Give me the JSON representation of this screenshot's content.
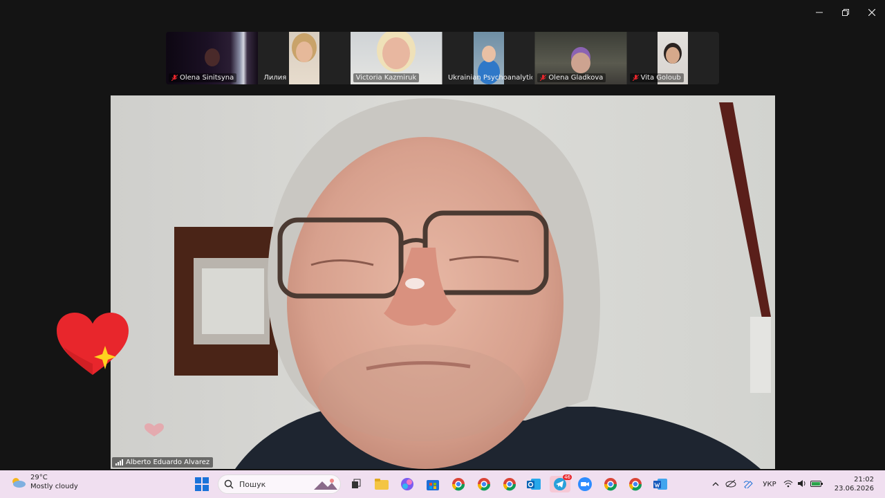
{
  "window": {
    "controls": [
      "minimize-icon",
      "restore-icon",
      "close-icon"
    ]
  },
  "participants": [
    {
      "name": "Olena Sinitsyna",
      "muted": true
    },
    {
      "name": "Лилия",
      "muted": false
    },
    {
      "name": "Victoria Kazmiruk",
      "muted": false
    },
    {
      "name": "Ukrainian Psychoanalytic ...",
      "muted": false
    },
    {
      "name": "Olena Gladkova",
      "muted": true
    },
    {
      "name": "Vita Goloub",
      "muted": true
    }
  ],
  "speaker": {
    "name": "Alberto Eduardo Alvarez"
  },
  "reactions": [
    "heart-icon",
    "sparkle-icon"
  ],
  "taskbar": {
    "weather": {
      "temp": "29°C",
      "desc": "Mostly cloudy"
    },
    "search_placeholder": "Пошук",
    "telegram_badge": "46",
    "language": "УКР",
    "time": "21:02",
    "date": "23.06.2026"
  },
  "colors": {
    "accent_red": "#e8262c",
    "taskbar_bg": "#f0dff0"
  }
}
